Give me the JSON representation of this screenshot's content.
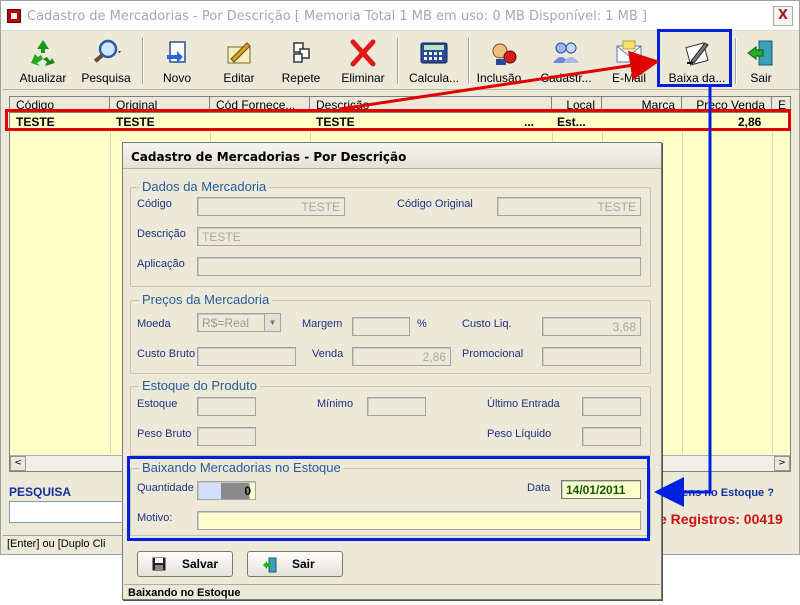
{
  "window": {
    "title": "Cadastro de Mercadorias - Por Descrição   [ Memoria Total 1  MB em uso: 0 MB  Disponível: 1 MB ]",
    "close_label": "X"
  },
  "toolbar": {
    "items": [
      {
        "label": "Atualizar",
        "icon": "recycle-icon"
      },
      {
        "label": "Pesquisa",
        "icon": "magnifier-icon"
      },
      {
        "label": "Novo",
        "icon": "new-document-icon"
      },
      {
        "label": "Editar",
        "icon": "edit-pencil-icon"
      },
      {
        "label": "Repete",
        "icon": "duplicate-icon"
      },
      {
        "label": "Eliminar",
        "icon": "red-x-icon"
      },
      {
        "label": "Calcula...",
        "icon": "calculator-icon"
      },
      {
        "label": "Inclusão...",
        "icon": "inclusion-icon"
      },
      {
        "label": "Cadastr...",
        "icon": "users-icon"
      },
      {
        "label": "E-Mail",
        "icon": "envelope-icon"
      },
      {
        "label": "Baixa da...",
        "icon": "stock-writeoff-icon"
      },
      {
        "label": "Sair",
        "icon": "exit-door-icon"
      }
    ]
  },
  "grid": {
    "columns": [
      "Código",
      "Original",
      "Cód Fornece...",
      "Descrição",
      "Local",
      "Marca",
      "Preço Venda",
      "E"
    ],
    "rows": [
      {
        "codigo": "TESTE",
        "original": "TESTE",
        "fornecedor": "",
        "descricao": "TESTE",
        "ellipsis": "...",
        "local": "Est...",
        "marca": "",
        "preco": "2,86"
      }
    ],
    "scroll_left": "<",
    "scroll_right": ">"
  },
  "search": {
    "label": "PESQUISA"
  },
  "info": {
    "question": "nte Itens no Estoque ?",
    "records": "e Registros: 00419"
  },
  "status": {
    "main": "[Enter] ou [Duplo Cli"
  },
  "dialog": {
    "title": "Cadastro de Mercadorias - Por Descrição",
    "dados": {
      "legend": "Dados da Mercadoria",
      "codigo_label": "Código",
      "codigo_value": "TESTE",
      "codigo_original_label": "Código Original",
      "codigo_original_value": "TESTE",
      "descricao_label": "Descrição",
      "descricao_value": "TESTE",
      "aplicacao_label": "Aplicação",
      "aplicacao_value": ""
    },
    "precos": {
      "legend": "Preços da Mercadoria",
      "moeda_label": "Moeda",
      "moeda_value": "R$=Real",
      "margem_label": "Margem",
      "margem_value": "",
      "percent": "%",
      "custo_liq_label": "Custo Liq.",
      "custo_liq_value": "3,68",
      "custo_bruto_label": "Custo Bruto",
      "custo_bruto_value": "",
      "venda_label": "Venda",
      "venda_value": "2,86",
      "promocional_label": "Promocional",
      "promocional_value": ""
    },
    "estoque": {
      "legend": "Estoque do Produto",
      "estoque_label": "Estoque",
      "minimo_label": "Mínimo",
      "ultimo_entrada_label": "Último Entrada",
      "peso_bruto_label": "Peso Bruto",
      "peso_liquido_label": "Peso Líquido"
    },
    "baixando": {
      "legend": "Baixando Mercadorias no Estoque",
      "quantidade_label": "Quantidade",
      "quantidade_value": "0",
      "data_label": "Data",
      "data_value": "14/01/2011",
      "motivo_label": "Motivo:",
      "motivo_value": ""
    },
    "buttons": {
      "salvar": "Salvar",
      "sair": "Sair"
    },
    "status": "Baixando no Estoque"
  },
  "colors": {
    "annotation_red": "#e00000",
    "annotation_blue": "#0020e0",
    "grid_background": "#ffffc8",
    "legend_blue": "#245c9c"
  }
}
